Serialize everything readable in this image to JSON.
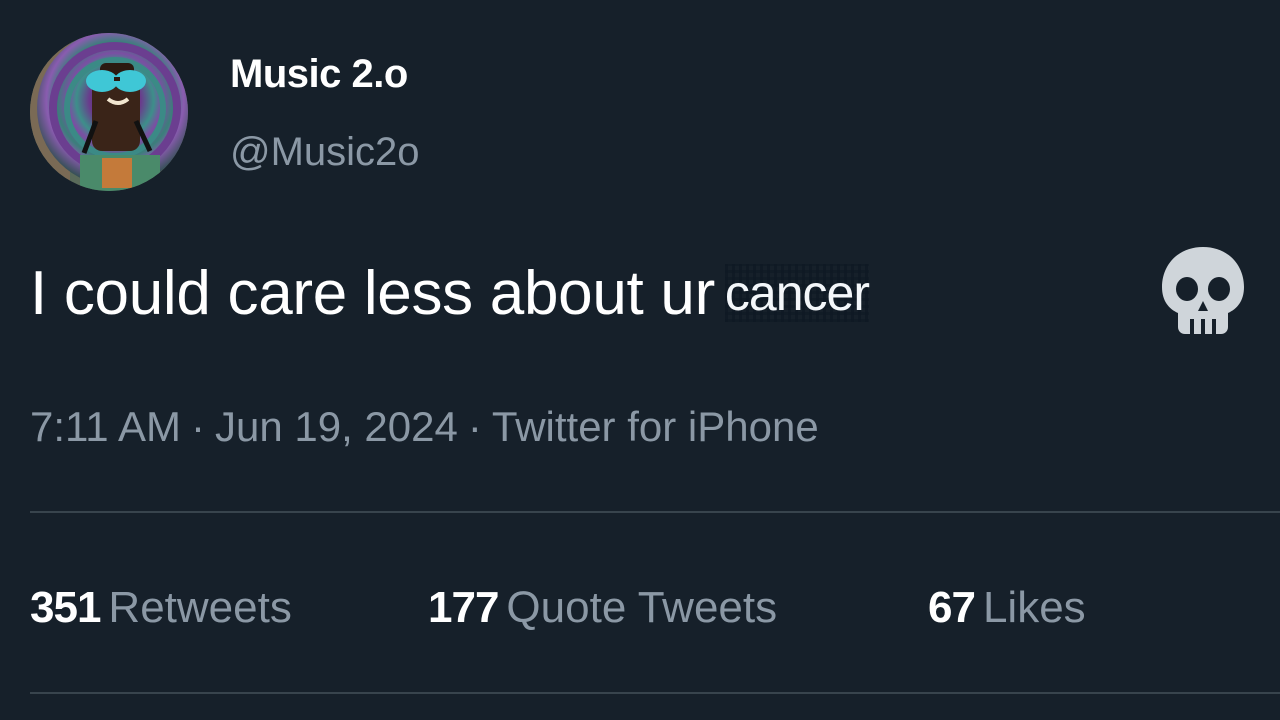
{
  "author": {
    "display_name": "Music 2.o",
    "handle": "@Music2o",
    "avatar_icon": "profile-avatar-cartoon"
  },
  "tweet": {
    "text": "I could care less about ur",
    "censored_word": "cancer",
    "emoji_icon": "skull-icon"
  },
  "meta": {
    "time": "7:11 AM",
    "separator": "·",
    "date": "Jun 19, 2024",
    "source": "Twitter for iPhone"
  },
  "stats": {
    "retweets_count": "351",
    "retweets_label": "Retweets",
    "quotes_count": "177",
    "quotes_label": "Quote Tweets",
    "likes_count": "67",
    "likes_label": "Likes"
  },
  "colors": {
    "background": "#16202a",
    "primary_text": "#ffffff",
    "secondary_text": "#8b98a5",
    "divider": "#38444d"
  }
}
